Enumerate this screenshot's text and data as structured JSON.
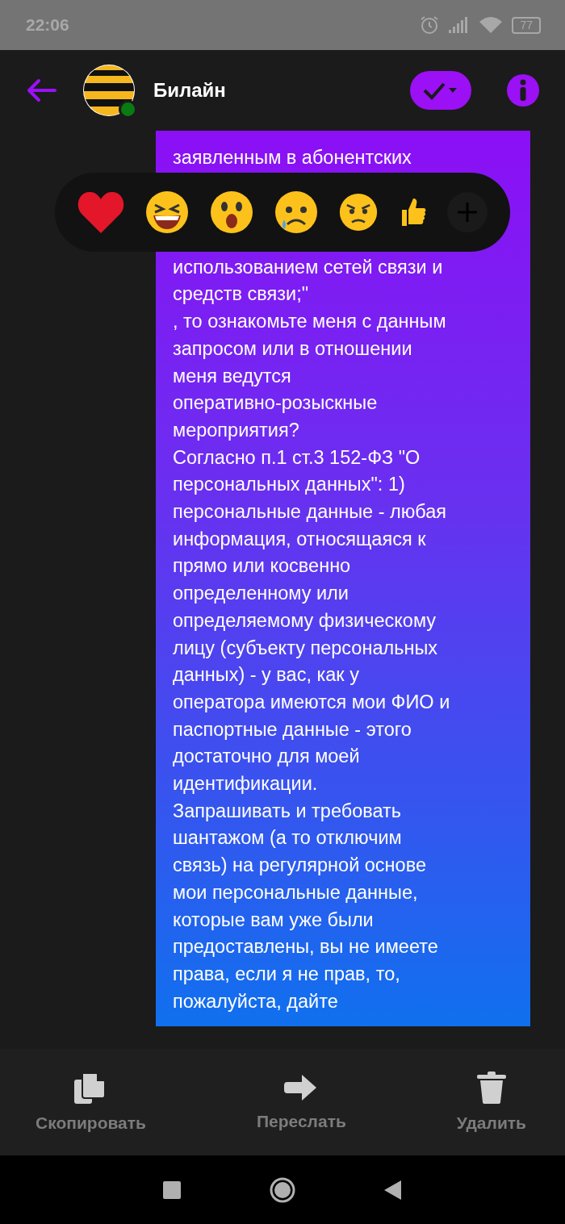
{
  "status_bar": {
    "time": "22:06",
    "battery": "77"
  },
  "header": {
    "title": "Билайн",
    "online": true
  },
  "message": {
    "above_reactions": {
      "lines": [
        "заявленным в абонентских"
      ]
    },
    "blocks": [
      {
        "lines": [
          "использованием сетей связи и",
          "средств связи;\""
        ]
      },
      {
        "lines": [
          ", то ознакомьте меня с данным",
          "запросом или в отношении",
          "меня ведутся",
          "оперативно-розыскные",
          "мероприятия?"
        ]
      },
      {
        "lines": [
          "Согласно п.1 ст.3 152-ФЗ \"О",
          "персональных данных\": 1)",
          "персональные данные - любая",
          "информация, относящаяся к",
          "прямо или косвенно",
          "определенному или",
          "определяемому физическому",
          "лицу (субъекту персональных",
          "данных) - у вас, как у",
          "оператора имеются мои ФИО и",
          "паспортные данные - этого",
          "достаточно для моей",
          "идентификации."
        ]
      },
      {
        "lines": [
          "Запрашивать и требовать",
          "шантажом (а то отключим",
          "связь) на регулярной основе",
          "мои персональные данные,",
          "которые вам уже были",
          "предоставлены, вы не имеете",
          "права, если я не прав, то,",
          "пожалуйста, дайте"
        ]
      }
    ]
  },
  "reactions": [
    {
      "kind": "heart"
    },
    {
      "kind": "laugh"
    },
    {
      "kind": "surprised"
    },
    {
      "kind": "sad"
    },
    {
      "kind": "angry"
    },
    {
      "kind": "thumbs"
    },
    {
      "kind": "plus"
    }
  ],
  "actions": [
    {
      "kind": "copy",
      "label": "Скопировать"
    },
    {
      "kind": "forward",
      "label": "Переслать"
    },
    {
      "kind": "delete",
      "label": "Удалить"
    }
  ]
}
